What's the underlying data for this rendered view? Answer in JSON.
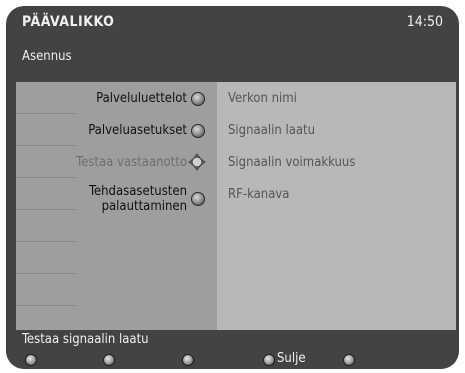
{
  "header": {
    "title": "PÄÄVALIKKO",
    "time": "14:50"
  },
  "section": {
    "title": "Asennus"
  },
  "menu": {
    "items": [
      {
        "label": "Palveluluettelot"
      },
      {
        "label": "Palveluasetukset"
      },
      {
        "label": "Testaa vastaanotto"
      },
      {
        "label": "Tehdasasetusten palauttaminen"
      }
    ]
  },
  "info": {
    "items": [
      {
        "label": "Verkon nimi"
      },
      {
        "label": "Signaalin laatu"
      },
      {
        "label": "Signaalin voimakkuus"
      },
      {
        "label": "RF-kanava"
      }
    ]
  },
  "status": {
    "text": "Testaa signaalin laatu"
  },
  "keys": {
    "close_label": "Sulje"
  },
  "colors": {
    "background": "#434343",
    "left_panel": "#9e9e9e",
    "right_panel": "#b8b8b8"
  }
}
